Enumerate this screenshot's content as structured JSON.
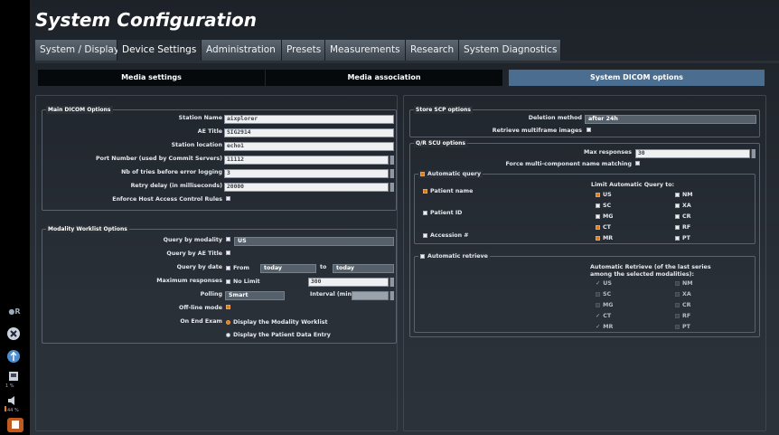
{
  "title": "System Configuration",
  "tabs": [
    "System / Display",
    "Device Settings",
    "Administration",
    "Presets",
    "Measurements",
    "Research",
    "System Diagnostics"
  ],
  "subtabs": [
    "Media settings",
    "Media association",
    "System DICOM options"
  ],
  "main_dicom": {
    "title": "Main DICOM Options",
    "station_name_label": "Station Name",
    "station_name": "aixplorer",
    "ae_title_label": "AE Title",
    "ae_title": "SIG2914",
    "station_location_label": "Station location",
    "station_location": "echo1",
    "port_label": "Port Number (used by Commit Servers)",
    "port": "11112",
    "tries_label": "Nb of tries before error logging",
    "tries": "3",
    "retry_label": "Retry delay (in milliseconds)",
    "retry": "20000",
    "enforce_label": "Enforce Host Access Control Rules"
  },
  "worklist": {
    "title": "Modality Worklist Options",
    "by_modality_label": "Query by modality",
    "modality": "US",
    "by_ae_label": "Query by AE Title",
    "by_date_label": "Query by date",
    "from_label": "From",
    "from": "today",
    "to_label": "to",
    "to": "today",
    "max_label": "Maximum responses",
    "nolimit_label": "No Limit",
    "max": "300",
    "polling_label": "Polling",
    "polling": "Smart",
    "interval_label": "Interval (min)",
    "offline_label": "Off-line mode",
    "onend_label": "On End Exam",
    "onend_opt1": "Display the Modality Worklist",
    "onend_opt2": "Display the Patient Data Entry"
  },
  "store": {
    "title": "Store SCP options",
    "deletion_label": "Deletion method",
    "deletion": "after 24h",
    "retrieve_label": "Retrieve multiframe images"
  },
  "qr": {
    "title": "Q/R SCU options",
    "max_label": "Max responses",
    "max": "30",
    "force_label": "Force multi-component name matching",
    "auto_query": "Automatic query",
    "limit_label": "Limit Automatic Query to:",
    "patient_name": "Patient name",
    "patient_id": "Patient ID",
    "accession": "Accession #",
    "q_mods": [
      "US",
      "NM",
      "SC",
      "XA",
      "MG",
      "CR",
      "CT",
      "RF",
      "MR",
      "PT"
    ],
    "auto_retrieve": "Automatic retrieve",
    "retrieve_label": "Automatic Retrieve (of the last series among the selected modalities):",
    "r_mods": [
      "US",
      "NM",
      "SC",
      "XA",
      "MG",
      "CR",
      "CT",
      "RF",
      "MR",
      "PT"
    ]
  },
  "sidebar": {
    "r_label": "R",
    "pct1": "1 %",
    "pct2": "44 %"
  },
  "colors": {
    "accent": "#4b6d90",
    "check_on": "#e07a20",
    "bg": "#2a3038"
  }
}
